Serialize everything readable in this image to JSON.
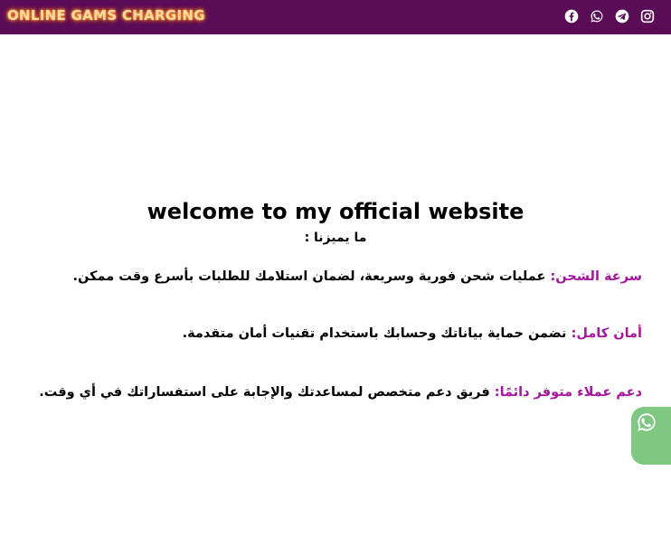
{
  "header": {
    "logo_text": "ONLINE GAMS CHARGING",
    "social_icons": [
      "facebook-icon",
      "whatsapp-icon",
      "telegram-icon",
      "instagram-icon"
    ],
    "bg_color": "#5a0c57"
  },
  "main": {
    "welcome_title": "welcome to my official website",
    "subtitle": "ما يميزنا :",
    "features": [
      {
        "title": "سرعة الشحن:",
        "text": "عمليات شحن فورية وسريعة، لضمان استلامك للطلبات بأسرع وقت ممكن."
      },
      {
        "title": "أمان كامل:",
        "text": "نضمن حماية بياناتك وحسابك باستخدام تقنيات أمان متقدمة."
      },
      {
        "title": "دعم عملاء متوفر دائمًا:",
        "text": "فريق دعم متخصص لمساعدتك والإجابة على استفساراتك في أي وقت."
      }
    ],
    "accent_color": "#a4169e"
  },
  "floating": {
    "icon": "whatsapp-icon",
    "color": "#81c784"
  }
}
